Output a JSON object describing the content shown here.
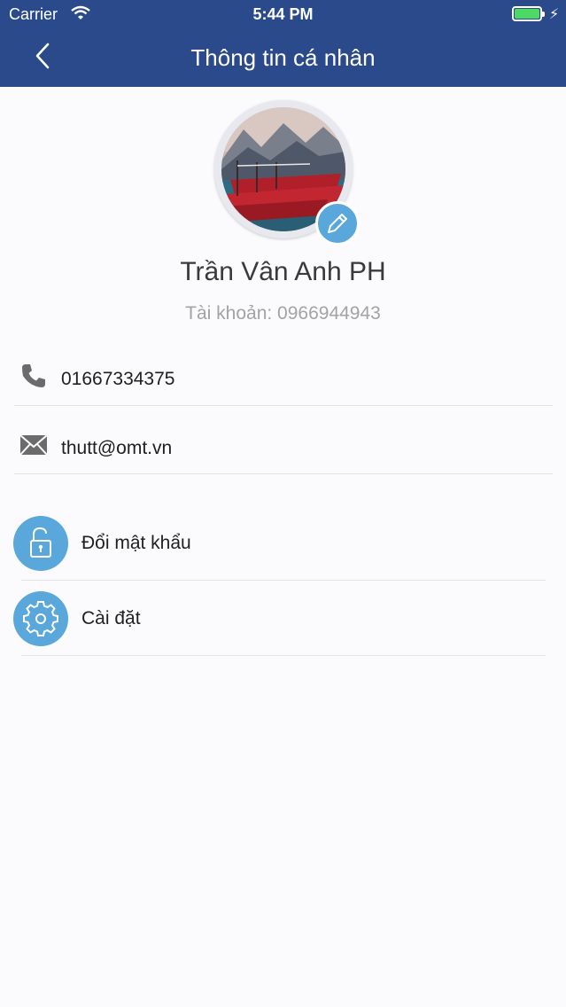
{
  "status_bar": {
    "carrier": "Carrier",
    "time": "5:44 PM"
  },
  "nav": {
    "title": "Thông tin cá nhân"
  },
  "profile": {
    "name": "Trần Vân Anh PH",
    "account": "Tài khoản: 0966944943"
  },
  "contact": {
    "phone": "01667334375",
    "email": "thutt@omt.vn"
  },
  "actions": {
    "change_password": "Đổi mật khẩu",
    "settings": "Cài đặt"
  },
  "colors": {
    "header": "#2b4a8b",
    "accent": "#5aa7db",
    "battery": "#4cd964"
  },
  "icons": [
    "wifi-icon",
    "battery-icon",
    "back-icon",
    "pencil-icon",
    "phone-icon",
    "mail-icon",
    "lock-icon",
    "gear-icon"
  ]
}
